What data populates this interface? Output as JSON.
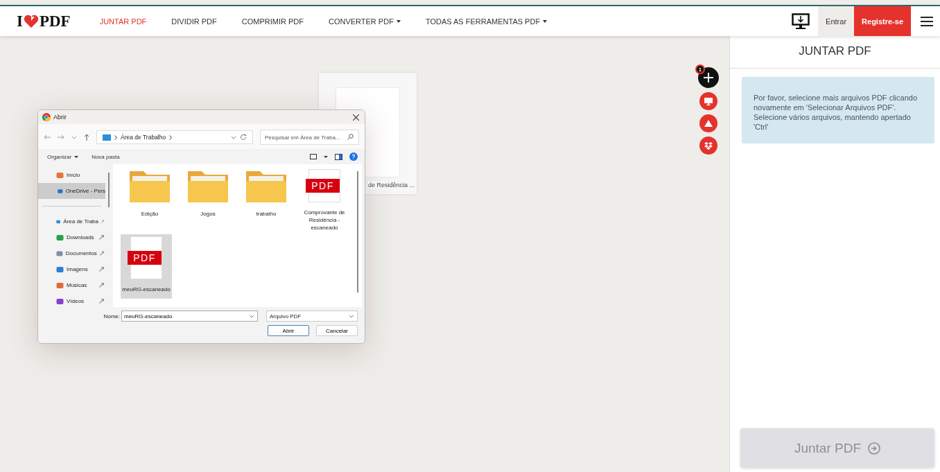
{
  "header": {
    "logo": {
      "left": "I",
      "right": "PDF"
    },
    "nav": [
      {
        "label": "JUNTAR PDF",
        "selected": true,
        "dropdown": false
      },
      {
        "label": "DIVIDIR PDF",
        "selected": false,
        "dropdown": false
      },
      {
        "label": "COMPRIMIR PDF",
        "selected": false,
        "dropdown": false
      },
      {
        "label": "CONVERTER PDF",
        "selected": false,
        "dropdown": true
      },
      {
        "label": "TODAS AS FERRAMENTAS PDF",
        "selected": false,
        "dropdown": true
      }
    ],
    "login": "Entrar",
    "signup": "Registre-se"
  },
  "workspace": {
    "file_card": {
      "caption": "de Residência ..."
    },
    "file_count": "1"
  },
  "dialog": {
    "title": "Abrir",
    "address": "Área de Trabalho",
    "search": {
      "placeholder": "Pesquisar em Área de Traba..."
    },
    "toolbar": {
      "organize": "Organizar",
      "new_folder": "Nova pasta"
    },
    "sidebar": [
      {
        "label": "Início",
        "kind": "home",
        "selected": false,
        "pinned": false
      },
      {
        "label": "OneDrive - Pers",
        "kind": "cloud",
        "selected": true,
        "pinned": false
      },
      {
        "label": "Área de Traba",
        "kind": "desktop",
        "selected": false,
        "pinned": true
      },
      {
        "label": "Downloads",
        "kind": "download",
        "selected": false,
        "pinned": true
      },
      {
        "label": "Documentos",
        "kind": "document",
        "selected": false,
        "pinned": true
      },
      {
        "label": "Imagens",
        "kind": "image",
        "selected": false,
        "pinned": true
      },
      {
        "label": "Músicas",
        "kind": "music",
        "selected": false,
        "pinned": true
      },
      {
        "label": "Vídeos",
        "kind": "video",
        "selected": false,
        "pinned": true
      }
    ],
    "files": [
      {
        "name": "Edição",
        "kind": "folder",
        "selected": false
      },
      {
        "name": "Jogos",
        "kind": "folder",
        "selected": false
      },
      {
        "name": "trabalho",
        "kind": "folder",
        "selected": false
      },
      {
        "name": "Comprovante de Residência - escaneado",
        "kind": "pdf",
        "selected": false,
        "icon_label": "PDF"
      },
      {
        "name": "meuRG-escaneado",
        "kind": "pdf",
        "selected": true,
        "icon_label": "PDF"
      }
    ],
    "filename_label": "Nome:",
    "filename": "meuRG-escaneado",
    "filetype": "Arquivo PDF",
    "open": "Abrir",
    "cancel": "Cancelar"
  },
  "panel": {
    "title": "JUNTAR PDF",
    "info": "Por favor, selecione mais arquivos PDF clicando novamente em 'Selecionar Arquivos PDF'. Selecione vários arquivos, mantendo apertado 'Ctrl'",
    "action": {
      "label": "Juntar PDF",
      "disabled": true
    }
  }
}
